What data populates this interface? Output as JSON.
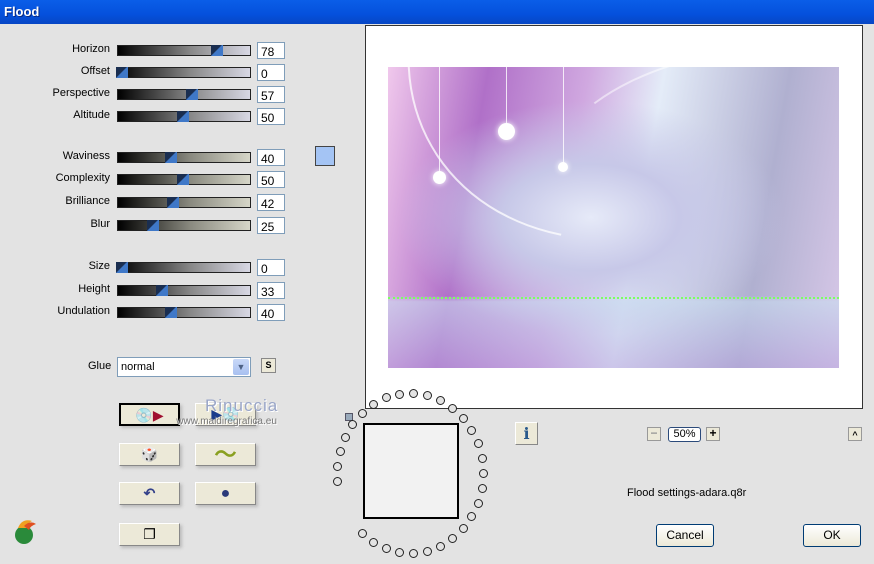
{
  "window": {
    "title": "Flood"
  },
  "sliders": [
    {
      "label": "Horizon",
      "value": 78,
      "group": 1
    },
    {
      "label": "Offset",
      "value": 0,
      "group": 1
    },
    {
      "label": "Perspective",
      "value": 57,
      "group": 1
    },
    {
      "label": "Altitude",
      "value": 50,
      "group": 1
    },
    {
      "label": "Waviness",
      "value": 40,
      "group": 2
    },
    {
      "label": "Complexity",
      "value": 50,
      "group": 2
    },
    {
      "label": "Brilliance",
      "value": 42,
      "group": 2
    },
    {
      "label": "Blur",
      "value": 25,
      "group": 2
    },
    {
      "label": "Size",
      "value": 0,
      "group": 3
    },
    {
      "label": "Height",
      "value": 33,
      "group": 3
    },
    {
      "label": "Undulation",
      "value": 40,
      "group": 3
    }
  ],
  "slider_values": [
    "78",
    "0",
    "57",
    "50",
    "40",
    "50",
    "42",
    "25",
    "0",
    "33",
    "40"
  ],
  "color_swatch": "#a4c4f4",
  "glue": {
    "label": "Glue",
    "value": "normal",
    "s_button": "S"
  },
  "watermark": {
    "name": "Rinuccia",
    "url": "www.maidiregrafica.eu"
  },
  "zoom": {
    "value": "50%",
    "minus": "−",
    "plus": "+",
    "collapse": "^"
  },
  "info_button": "i",
  "filename": "Flood settings-adara.q8r",
  "buttons": {
    "cancel": "Cancel",
    "ok": "OK"
  }
}
